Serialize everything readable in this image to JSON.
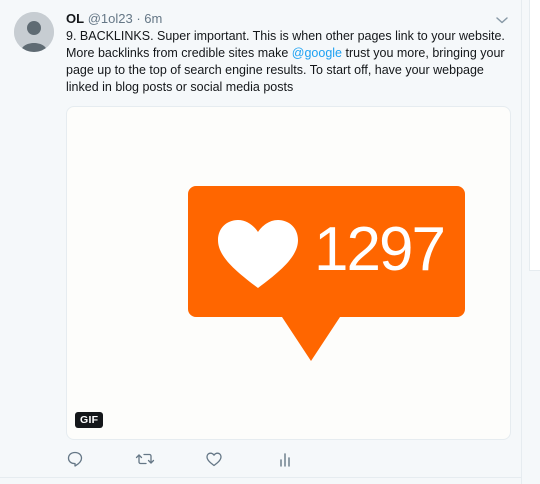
{
  "tweet": {
    "author_name": "OL",
    "handle": "@1ol23",
    "separator": "·",
    "time": "6m",
    "text_before_mention": "9. BACKLINKS. Super important. This is when other pages link to your website. More backlinks from credible sites make ",
    "mention": "@google",
    "text_after_mention": " trust you more, bringing your page up to the top of search engine results. To start off, have your webpage linked in blog posts or social media posts"
  },
  "media": {
    "like_count": "1297",
    "badge": "GIF",
    "colors": {
      "bubble": "#ff6600",
      "background": "#fdfdfb"
    }
  },
  "actions": {
    "icons": [
      "reply-icon",
      "retweet-icon",
      "like-icon",
      "analytics-icon"
    ]
  },
  "colors": {
    "link": "#1da1f2",
    "muted": "#657786",
    "text": "#14171a"
  }
}
